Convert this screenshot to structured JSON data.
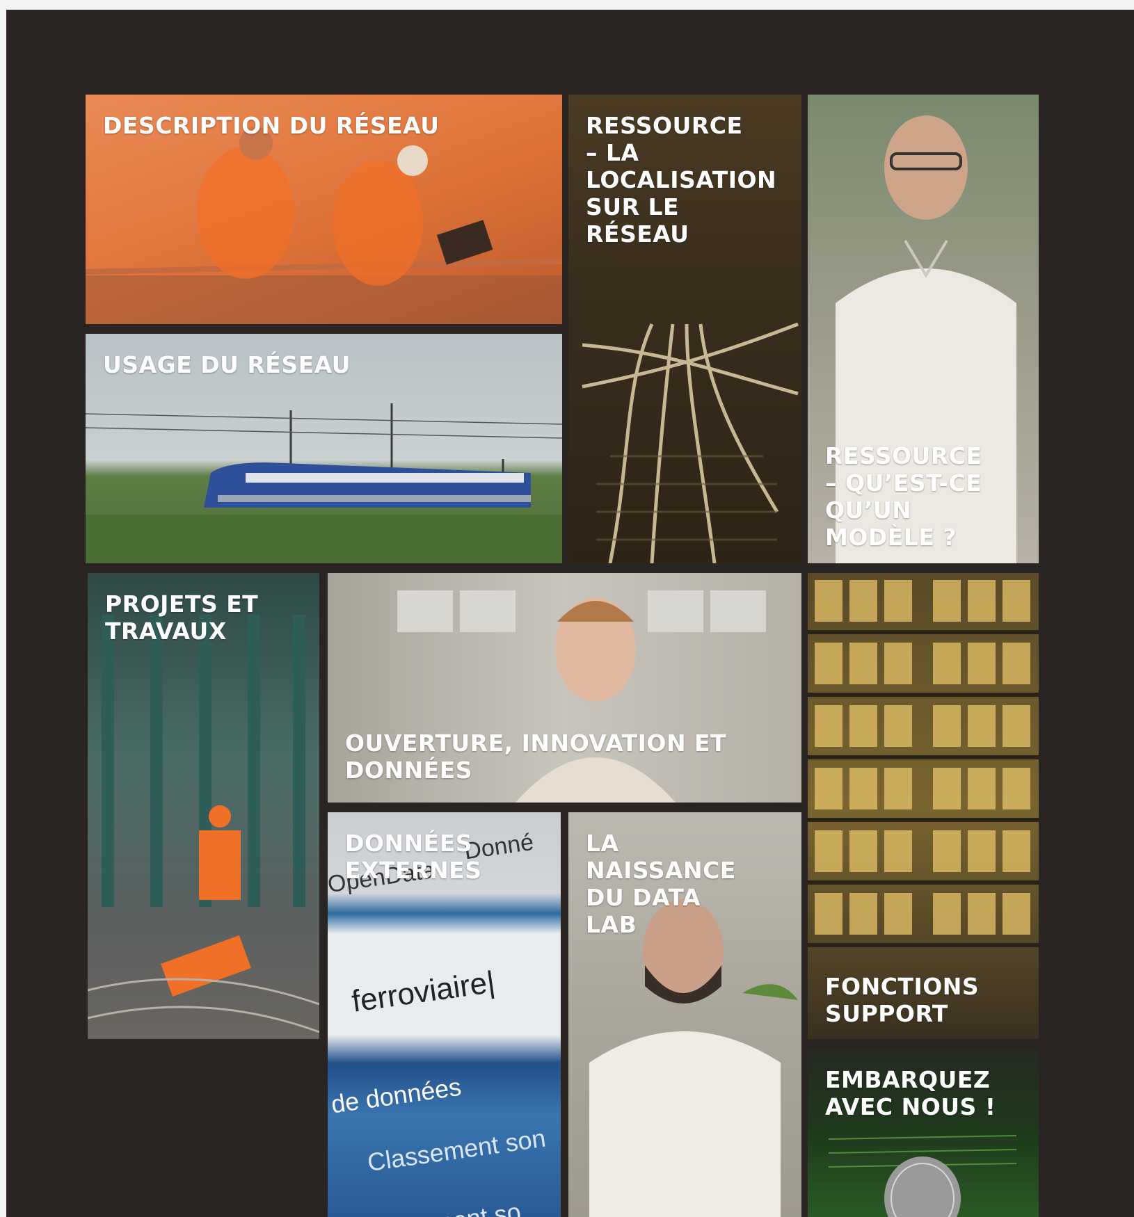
{
  "tiles": [
    {
      "id": "description",
      "label": "DESCRIPTION DU RÉSEAU",
      "color": "#e0773e"
    },
    {
      "id": "localisation",
      "label": "RESSOURCE\n– LA\nLOCALISATION\nSUR LE\nRÉSEAU",
      "color": "#5a4a2a"
    },
    {
      "id": "modele",
      "label": "RESSOURCE\n– QU’EST-CE\nQU’UN\nMODÈLE ?",
      "color": "#b9b3a8"
    },
    {
      "id": "usage",
      "label": "USAGE DU RÉSEAU",
      "color": "#6b8a5a"
    },
    {
      "id": "projets",
      "label": "PROJETS ET\nTRAVAUX",
      "color": "#4a6b66"
    },
    {
      "id": "ouverture",
      "label": "OUVERTURE, INNOVATION ET\nDONNÉES",
      "color": "#b8b2a8"
    },
    {
      "id": "fonctions",
      "label": "FONCTIONS\nSUPPORT",
      "color": "#6b5a2a"
    },
    {
      "id": "externes",
      "label": "DONNÉES\nEXTERNES",
      "color": "#3a6a94"
    },
    {
      "id": "datalab",
      "label": "LA\nNAISSANCE\nDU DATA\nLAB",
      "color": "#a8a298"
    },
    {
      "id": "embarquez",
      "label": "EMBARQUEZ\nAVEC NOUS !",
      "color": "#1f3a1f"
    }
  ],
  "photo_text": {
    "opendata": "l'OpenData",
    "donnees_fragment": "Donné",
    "search_word": "ferroviaire|",
    "de_donnees": "de données",
    "classement1": "Classement son",
    "classement2": "Classement so"
  }
}
